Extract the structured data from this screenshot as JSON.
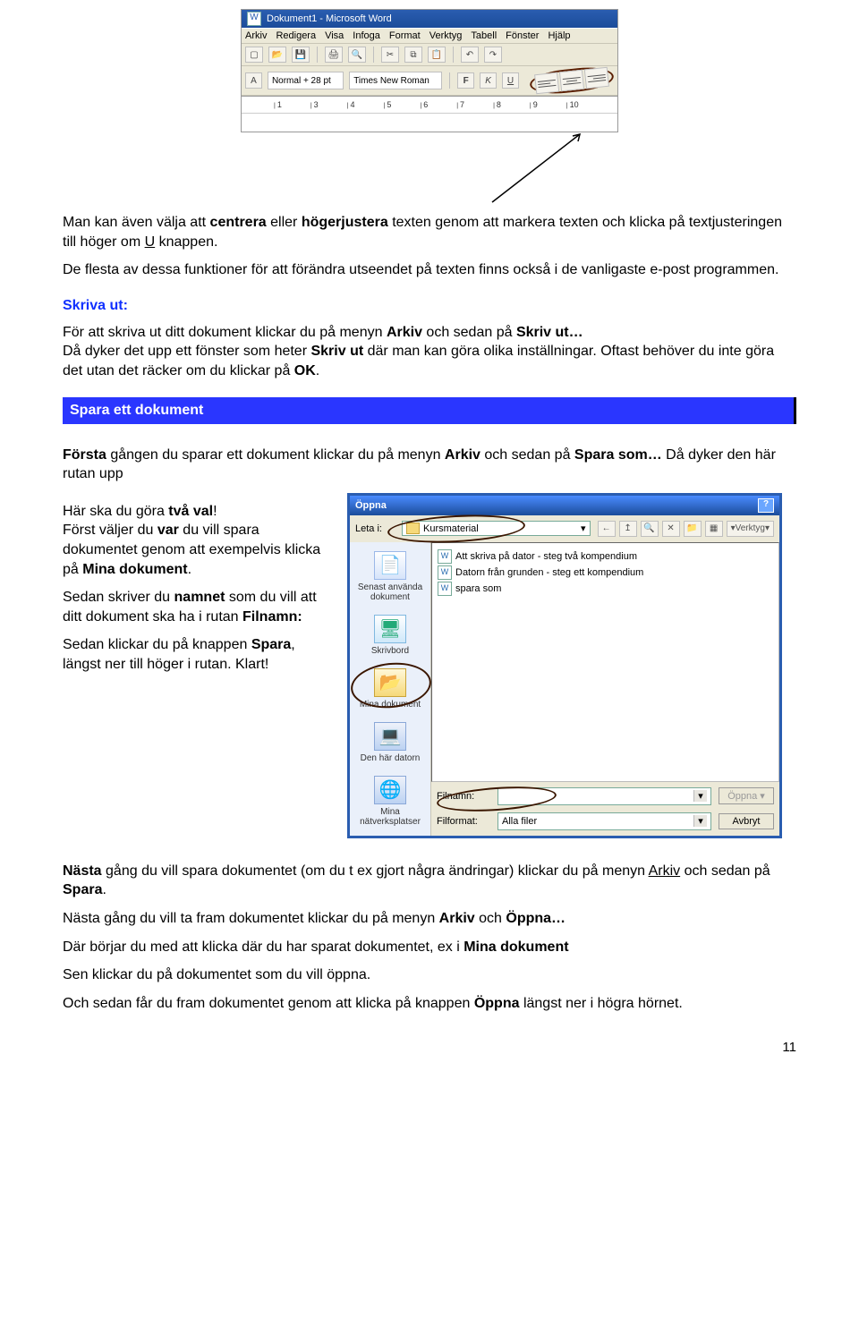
{
  "toolbar": {
    "window_title": "Dokument1 - Microsoft Word",
    "menus": [
      "Arkiv",
      "Redigera",
      "Visa",
      "Infoga",
      "Format",
      "Verktyg",
      "Tabell",
      "Fönster",
      "Hjälp"
    ],
    "style_field": "Normal + 28 pt",
    "font_field": "Times New Roman",
    "ruler_marks": [
      "1",
      "3",
      "4",
      "5",
      "6",
      "7",
      "8",
      "9",
      "10"
    ]
  },
  "para1_a": "Man kan även välja att ",
  "para1_b": "centrera",
  "para1_c": " eller ",
  "para1_d": "högerjustera",
  "para1_e": " texten genom att markera texten och klicka på textjusteringen till höger om ",
  "para1_f": "U",
  "para1_g": " knappen.",
  "para2": "De flesta av dessa funktioner för att förändra utseendet på texten finns också i de vanligaste e-post programmen.",
  "hdr_skrivaut": "Skriva ut:",
  "para3_a": "För att skriva ut ditt dokument klickar du på menyn ",
  "para3_b": "Arkiv",
  "para3_c": " och sedan på ",
  "para3_d": "Skriv ut…",
  "para4_a": "Då dyker det upp ett fönster som heter ",
  "para4_b": "Skriv ut",
  "para4_c": " där man kan göra olika inställningar. Oftast behöver du inte göra det utan det räcker om du klickar på ",
  "para4_d": "OK",
  "para4_e": ".",
  "blue_bar": "Spara ett dokument",
  "para5_a": "Första",
  "para5_b": " gången du sparar ett dokument klickar du på menyn ",
  "para5_c": "Arkiv",
  "para5_d": " och sedan på ",
  "para5_e": "Spara som…",
  "para5_f": " Då dyker den här rutan upp",
  "left1_a": "Här ska du göra ",
  "left1_b": "två val",
  "left1_c": "!",
  "left2_a": "Först väljer du ",
  "left2_b": "var",
  "left2_c": " du vill spara dokumentet genom att exempelvis klicka på ",
  "left2_d": "Mina dokument",
  "left2_e": ".",
  "left3_a": "Sedan skriver du ",
  "left3_b": "namnet",
  "left3_c": " som du vill att ditt dokument ska ha i rutan ",
  "left3_d": "Filnamn:",
  "left4_a": "Sedan klickar du på knappen ",
  "left4_b": "Spara",
  "left4_c": ", längst ner till höger i rutan. Klart!",
  "dialog": {
    "title": "Öppna",
    "lookin_label": "Leta i:",
    "lookin_value": "Kursmaterial",
    "tools_label": "Verktyg",
    "side": {
      "recent": "Senast använda dokument",
      "desktop": "Skrivbord",
      "mydocs": "Mina dokument",
      "computer": "Den här datorn",
      "network": "Mina nätverksplatser"
    },
    "files": [
      "Att skriva på dator - steg två kompendium",
      "Datorn från grunden - steg ett kompendium",
      "spara som"
    ],
    "filename_label": "Filnamn:",
    "filetype_label": "Filformat:",
    "filetype_value": "Alla filer",
    "open_btn": "Öppna",
    "cancel_btn": "Avbryt"
  },
  "para6_a": "Nästa",
  "para6_b": " gång du vill spara dokumentet (om du t ex gjort några ändringar) klickar du på menyn ",
  "para6_c": "Arkiv",
  "para6_d": " och sedan på ",
  "para6_e": "Spara",
  "para6_f": ".",
  "para7_a": "Nästa gång du vill ta fram dokumentet klickar du på menyn ",
  "para7_b": "Arkiv",
  "para7_c": " och ",
  "para7_d": "Öppna…",
  "para8_a": "Där börjar du med att klicka där du har sparat dokumentet, ex i ",
  "para8_b": "Mina dokument",
  "para9": "Sen klickar du på dokumentet som du vill öppna.",
  "para10_a": "Och sedan får du fram dokumentet genom att klicka på knappen ",
  "para10_b": "Öppna",
  "para10_c": " längst ner i högra hörnet.",
  "page_number": "11"
}
